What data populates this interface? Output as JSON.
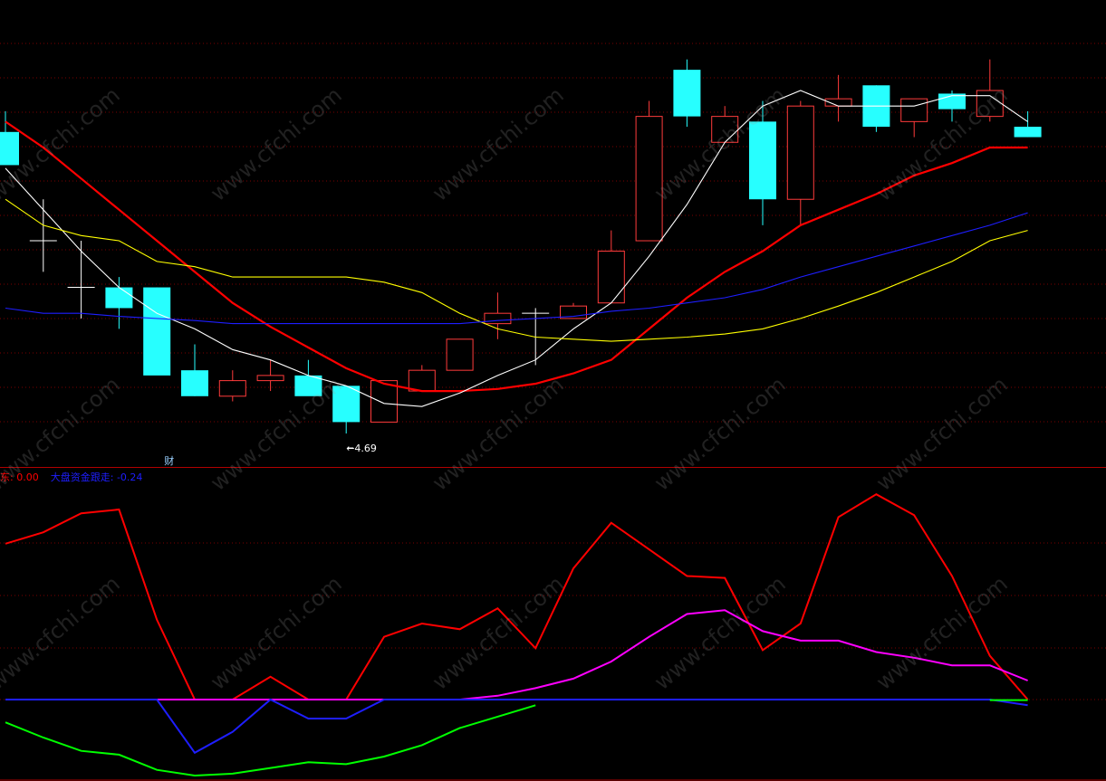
{
  "chart_data": [
    {
      "type": "candlestick",
      "panel": "main",
      "candles": [
        {
          "open": 7.6,
          "high": 7.8,
          "low": 7.5,
          "close": 7.28,
          "dir": "down"
        },
        {
          "open": 6.55,
          "high": 6.95,
          "low": 6.25,
          "close": 6.55,
          "dir": "doji"
        },
        {
          "open": 6.1,
          "high": 6.55,
          "low": 5.8,
          "close": 6.1,
          "dir": "doji"
        },
        {
          "open": 6.1,
          "high": 6.2,
          "low": 5.7,
          "close": 5.9,
          "dir": "down"
        },
        {
          "open": 6.1,
          "high": 6.1,
          "low": 5.4,
          "close": 5.25,
          "dir": "down"
        },
        {
          "open": 5.3,
          "high": 5.55,
          "low": 5.05,
          "close": 5.05,
          "dir": "down"
        },
        {
          "open": 5.05,
          "high": 5.3,
          "low": 5.0,
          "close": 5.2,
          "dir": "up"
        },
        {
          "open": 5.2,
          "high": 5.4,
          "low": 5.1,
          "close": 5.25,
          "dir": "up"
        },
        {
          "open": 5.25,
          "high": 5.4,
          "low": 5.08,
          "close": 5.05,
          "dir": "down"
        },
        {
          "open": 5.15,
          "high": 5.15,
          "low": 4.69,
          "close": 4.8,
          "dir": "down"
        },
        {
          "open": 4.8,
          "high": 5.2,
          "low": 4.8,
          "close": 5.2,
          "dir": "up"
        },
        {
          "open": 5.1,
          "high": 5.35,
          "low": 5.1,
          "close": 5.3,
          "dir": "up"
        },
        {
          "open": 5.3,
          "high": 5.6,
          "low": 5.3,
          "close": 5.6,
          "dir": "up"
        },
        {
          "open": 5.75,
          "high": 6.05,
          "low": 5.6,
          "close": 5.85,
          "dir": "up"
        },
        {
          "open": 5.85,
          "high": 5.9,
          "low": 5.35,
          "close": 5.85,
          "dir": "doji"
        },
        {
          "open": 5.8,
          "high": 5.95,
          "low": 5.8,
          "close": 5.92,
          "dir": "up"
        },
        {
          "open": 5.95,
          "high": 6.65,
          "low": 5.95,
          "close": 6.45,
          "dir": "up"
        },
        {
          "open": 6.55,
          "high": 7.9,
          "low": 6.55,
          "close": 7.75,
          "dir": "up"
        },
        {
          "open": 8.2,
          "high": 8.3,
          "low": 7.65,
          "close": 7.75,
          "dir": "down"
        },
        {
          "open": 7.5,
          "high": 7.85,
          "low": 7.5,
          "close": 7.75,
          "dir": "up"
        },
        {
          "open": 7.7,
          "high": 7.9,
          "low": 6.7,
          "close": 6.95,
          "dir": "down"
        },
        {
          "open": 6.95,
          "high": 7.9,
          "low": 6.7,
          "close": 7.85,
          "dir": "up"
        },
        {
          "open": 7.85,
          "high": 8.15,
          "low": 7.7,
          "close": 7.92,
          "dir": "up"
        },
        {
          "open": 8.05,
          "high": 8.05,
          "low": 7.6,
          "close": 7.65,
          "dir": "down"
        },
        {
          "open": 7.7,
          "high": 7.9,
          "low": 7.55,
          "close": 7.92,
          "dir": "up"
        },
        {
          "open": 7.97,
          "high": 8.0,
          "low": 7.7,
          "close": 7.82,
          "dir": "down"
        },
        {
          "open": 7.75,
          "high": 8.3,
          "low": 7.7,
          "close": 8.0,
          "dir": "up"
        },
        {
          "open": 7.65,
          "high": 7.8,
          "low": 7.55,
          "close": 7.55,
          "dir": "down"
        }
      ],
      "series": [
        {
          "color": "#ff0000",
          "values": [
            7.7,
            7.45,
            7.15,
            6.85,
            6.55,
            6.25,
            5.95,
            5.72,
            5.52,
            5.32,
            5.17,
            5.1,
            5.1,
            5.12,
            5.17,
            5.27,
            5.4,
            5.7,
            6.0,
            6.25,
            6.45,
            6.7,
            6.85,
            7.0,
            7.18,
            7.3,
            7.45,
            7.45
          ]
        },
        {
          "color": "#ffffff",
          "values": [
            7.25,
            6.85,
            6.45,
            6.1,
            5.85,
            5.7,
            5.5,
            5.4,
            5.25,
            5.15,
            4.98,
            4.95,
            5.08,
            5.25,
            5.4,
            5.7,
            5.95,
            6.4,
            6.9,
            7.5,
            7.85,
            8.0,
            7.85,
            7.85,
            7.85,
            7.95,
            7.95,
            7.7
          ]
        },
        {
          "color": "#ffff00",
          "values": [
            6.95,
            6.7,
            6.6,
            6.55,
            6.35,
            6.3,
            6.2,
            6.2,
            6.2,
            6.2,
            6.15,
            6.05,
            5.85,
            5.7,
            5.62,
            5.6,
            5.58,
            5.6,
            5.62,
            5.65,
            5.7,
            5.8,
            5.92,
            6.05,
            6.2,
            6.35,
            6.55,
            6.65
          ]
        },
        {
          "color": "#1e1eff",
          "values": [
            5.9,
            5.85,
            5.85,
            5.82,
            5.8,
            5.78,
            5.75,
            5.75,
            5.75,
            5.75,
            5.75,
            5.75,
            5.75,
            5.78,
            5.8,
            5.82,
            5.87,
            5.9,
            5.95,
            6.0,
            6.08,
            6.2,
            6.3,
            6.4,
            6.5,
            6.6,
            6.7,
            6.82
          ]
        }
      ],
      "annotations": [
        {
          "text": "4.69",
          "at": 9
        },
        {
          "text": "财",
          "at": 4
        }
      ]
    },
    {
      "type": "line",
      "panel": "indicator",
      "series": [
        {
          "color": "#ff0000",
          "values": [
            82,
            88,
            98,
            100,
            42,
            0,
            0,
            12,
            0,
            0,
            33,
            40,
            37,
            48,
            27,
            69,
            93,
            79,
            65,
            64,
            26,
            40,
            96,
            108,
            97,
            65,
            23,
            0
          ]
        },
        {
          "color": "#ff00ff",
          "values": [
            null,
            null,
            null,
            null,
            0,
            0,
            0,
            0,
            0,
            0,
            0,
            0,
            0,
            2,
            6,
            11,
            20,
            33,
            45,
            47,
            36,
            31,
            31,
            25,
            22,
            18,
            18,
            10
          ]
        },
        {
          "color": "#1e1eff",
          "values": [
            0,
            0,
            0,
            0,
            0,
            -28,
            -17,
            0,
            -10,
            -10,
            0,
            0,
            0,
            0,
            0,
            0,
            0,
            0,
            0,
            0,
            0,
            0,
            0,
            0,
            0,
            0,
            0,
            -3
          ]
        },
        {
          "color": "#00ff00",
          "values": [
            -12,
            -20,
            -27,
            -29,
            -37,
            -40,
            -39,
            -36,
            -33,
            -34,
            -30,
            -24,
            -15,
            -9,
            -3,
            null,
            null,
            null,
            null,
            null,
            null,
            null,
            null,
            null,
            null,
            null,
            -0.3,
            -0.3
          ]
        }
      ],
      "legend": [
        {
          "label": "东",
          "value": "0.00",
          "color": "#ff0000"
        },
        {
          "label": "大盘资金跟走:",
          "value": "-0.24",
          "color": "#1e1eff"
        }
      ]
    }
  ],
  "watermark": "www.cfchi.com"
}
